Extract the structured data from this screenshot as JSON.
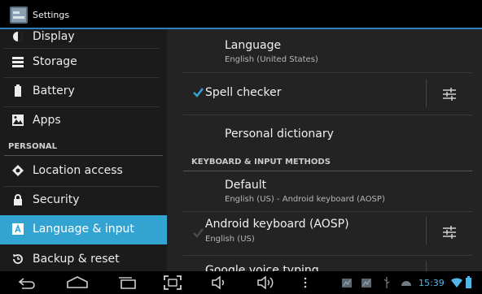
{
  "window": {
    "title": "Settings",
    "icon": "settings-app-icon"
  },
  "sidebar": {
    "items": [
      {
        "label": "Display",
        "icon": "display-icon"
      },
      {
        "label": "Storage",
        "icon": "storage-icon"
      },
      {
        "label": "Battery",
        "icon": "battery-icon"
      },
      {
        "label": "Apps",
        "icon": "apps-icon"
      },
      {
        "label": "Location access",
        "icon": "location-icon"
      },
      {
        "label": "Security",
        "icon": "lock-icon"
      },
      {
        "label": "Language & input",
        "icon": "language-icon",
        "selected": true
      },
      {
        "label": "Backup & reset",
        "icon": "backup-icon"
      }
    ],
    "personal_header": "PERSONAL"
  },
  "content": {
    "language": {
      "title": "Language",
      "summary": "English (United States)"
    },
    "spell_checker": {
      "title": "Spell checker",
      "checked": true
    },
    "personal_dictionary": {
      "title": "Personal dictionary"
    },
    "keyboard_header": "KEYBOARD & INPUT METHODS",
    "default": {
      "title": "Default",
      "summary": "English (US) - Android keyboard (AOSP)"
    },
    "android_keyboard": {
      "title": "Android keyboard (AOSP)",
      "summary": "English (US)",
      "checked": true,
      "enabled": false
    },
    "google_voice": {
      "title": "Google voice typing"
    }
  },
  "status": {
    "time": "15:39"
  },
  "colors": {
    "accent": "#33a4d2",
    "title_line": "#2e7fbf",
    "status": "#52b6e6"
  }
}
